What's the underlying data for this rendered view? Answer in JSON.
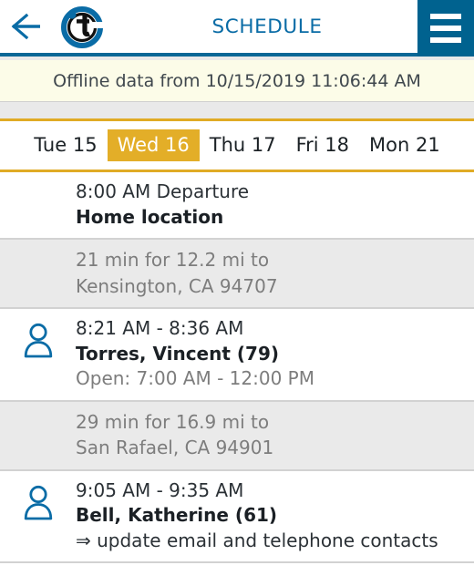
{
  "header": {
    "back_icon": "arrow-left-icon",
    "logo_icon": "brand-t-logo-icon",
    "title": "SCHEDULE",
    "menu_icon": "hamburger-menu-icon",
    "title_color": "#0a6ca6",
    "menu_bg_color": "#00628f",
    "accent_underline_color": "#0a6796"
  },
  "offline_banner": {
    "text": "Offline data from 10/15/2019 11:06:44 AM",
    "bg_color": "#fcfce8"
  },
  "date_tabs": {
    "active_color": "#e3ae28",
    "items": [
      {
        "label": "Tue 15",
        "active": false
      },
      {
        "label": "Wed 16",
        "active": true
      },
      {
        "label": "Thu 17",
        "active": false
      },
      {
        "label": "Fri 18",
        "active": false
      },
      {
        "label": "Mon 21",
        "active": false
      }
    ]
  },
  "schedule": {
    "rows": [
      {
        "type": "stop",
        "icon": "none",
        "time": "8:00 AM Departure",
        "name": "Home location",
        "sub": "",
        "note": ""
      },
      {
        "type": "travel",
        "icon": "none",
        "line1": "21 min for 12.2 mi to",
        "line2": "Kensington, CA 94707"
      },
      {
        "type": "stop",
        "icon": "person-icon",
        "time": "8:21 AM - 8:36 AM",
        "name": "Torres, Vincent (79)",
        "sub": "Open: 7:00 AM - 12:00 PM",
        "note": ""
      },
      {
        "type": "travel",
        "icon": "none",
        "line1": "29 min for 16.9 mi to",
        "line2": "San Rafael, CA 94901"
      },
      {
        "type": "stop",
        "icon": "person-icon",
        "time": "9:05 AM - 9:35 AM",
        "name": "Bell, Katherine (61)",
        "sub": "",
        "note": "⇒ update email and telephone contacts"
      }
    ]
  }
}
